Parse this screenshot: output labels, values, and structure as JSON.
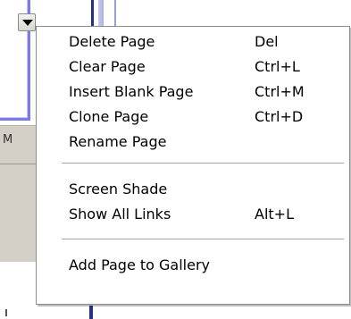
{
  "background": {
    "partial_text": "M"
  },
  "context_menu": {
    "items": [
      {
        "label": "Delete Page",
        "shortcut": "Del"
      },
      {
        "label": "Clear Page",
        "shortcut": "Ctrl+L"
      },
      {
        "label": "Insert Blank Page",
        "shortcut": "Ctrl+M"
      },
      {
        "label": "Clone Page",
        "shortcut": "Ctrl+D"
      },
      {
        "label": "Rename Page",
        "shortcut": ""
      },
      {
        "label": "Screen Shade",
        "shortcut": ""
      },
      {
        "label": "Show All Links",
        "shortcut": "Alt+L"
      },
      {
        "label": "Add Page to Gallery",
        "shortcut": ""
      }
    ]
  },
  "icons": {
    "dropdown_button": "chevron-down-icon"
  },
  "colors": {
    "menu_background": "#ffffff",
    "menu_border": "#8c8c8c",
    "separator": "#a3a3a3",
    "panel_gray": "#d4d0c8",
    "selection_frame": "#7b7be6"
  }
}
